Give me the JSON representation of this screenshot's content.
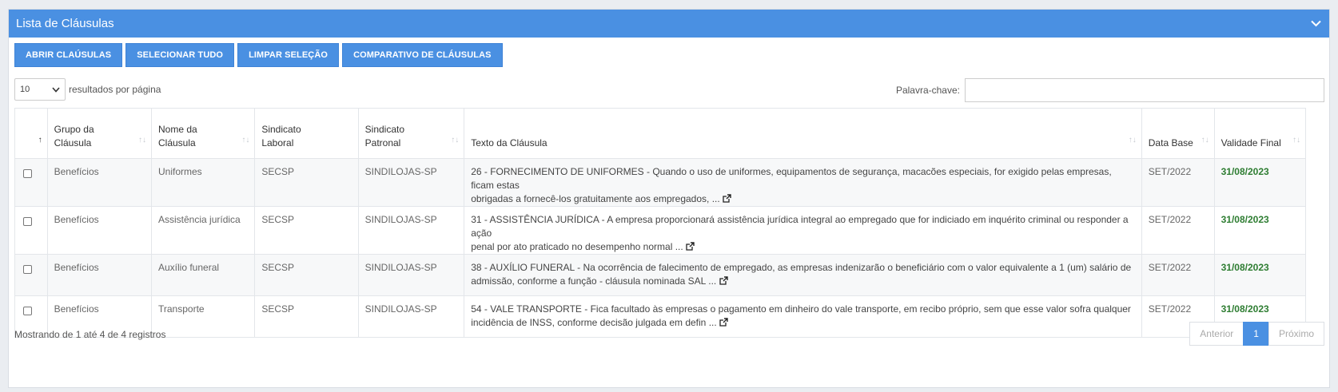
{
  "panel": {
    "title": "Lista de Cláusulas"
  },
  "toolbar": {
    "buttons": [
      {
        "label": "ABRIR CLAÚSULAS"
      },
      {
        "label": "SELECIONAR TUDO"
      },
      {
        "label": "LIMPAR SELEÇÃO"
      },
      {
        "label": "COMPARATIVO DE CLÁUSULAS"
      }
    ]
  },
  "length": {
    "value": "10",
    "label": "resultados por página"
  },
  "search": {
    "label": "Palavra-chave:",
    "value": ""
  },
  "table": {
    "headers": {
      "group": [
        "Grupo da",
        "Cláusula"
      ],
      "name": [
        "Nome da",
        "Cláusula"
      ],
      "labor": [
        "Sindicato",
        "Laboral"
      ],
      "employer": [
        "Sindicato",
        "Patronal"
      ],
      "text": "Texto da Cláusula",
      "base": "Data Base",
      "validity": "Validade Final"
    },
    "rows": [
      {
        "group": "Benefícios",
        "name": "Uniformes",
        "labor": "SECSP",
        "employer": "SINDILOJAS-SP",
        "text_line1": "26 - FORNECIMENTO DE UNIFORMES - Quando o uso de uniformes, equipamentos de segurança, macacões especiais, for exigido pelas empresas, ficam estas",
        "text_line2": "obrigadas a fornecê-los gratuitamente aos empregados, ...",
        "base": "SET/2022",
        "validity": "31/08/2023"
      },
      {
        "group": "Benefícios",
        "name": "Assistência jurídica",
        "labor": "SECSP",
        "employer": "SINDILOJAS-SP",
        "text_line1": "31 - ASSISTÊNCIA JURÍDICA - A empresa proporcionará assistência jurídica integral ao empregado que for indiciado em inquérito criminal ou responder a ação",
        "text_line2": "penal por ato praticado no desempenho normal ...",
        "base": "SET/2022",
        "validity": "31/08/2023"
      },
      {
        "group": "Benefícios",
        "name": "Auxílio funeral",
        "labor": "SECSP",
        "employer": "SINDILOJAS-SP",
        "text_line1": "38 - AUXÍLIO FUNERAL - Na ocorrência de falecimento de empregado, as empresas indenizarão o beneficiário com o valor equivalente a 1 (um) salário de",
        "text_line2": "admissão, conforme a função - cláusula nominada SAL ...",
        "base": "SET/2022",
        "validity": "31/08/2023"
      },
      {
        "group": "Benefícios",
        "name": "Transporte",
        "labor": "SECSP",
        "employer": "SINDILOJAS-SP",
        "text_line1": "54 - VALE TRANSPORTE - Fica facultado às empresas o pagamento em dinheiro do vale transporte, em recibo próprio, sem que esse valor sofra qualquer",
        "text_line2": "incidência de INSS, conforme decisão julgada em defin ...",
        "base": "SET/2022",
        "validity": "31/08/2023"
      }
    ]
  },
  "footer": {
    "info": "Mostrando de 1 até 4 de 4 registros",
    "prev": "Anterior",
    "page": "1",
    "next": "Próximo"
  },
  "colors": {
    "accent": "#4a90e2",
    "validity": "#2e7d32"
  }
}
